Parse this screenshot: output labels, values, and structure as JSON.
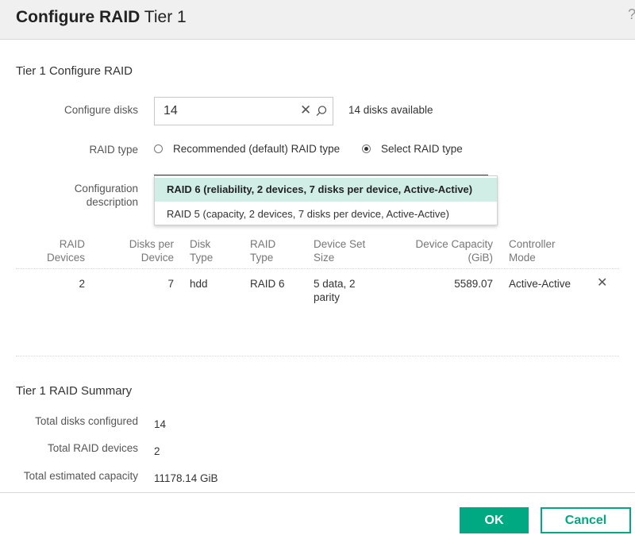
{
  "header": {
    "title_bold": "Configure RAID",
    "title_rest": "Tier 1",
    "help_icon": "help-icon"
  },
  "configure": {
    "section_title": "Tier 1 Configure RAID",
    "disks_label": "Configure disks",
    "disks_value": "14",
    "disks_available": "14 disks available",
    "raid_type_label": "RAID type",
    "raid_options": [
      "Recommended (default) RAID type",
      "Select RAID type"
    ],
    "raid_selected": "Select RAID type",
    "config_desc_label_1": "Configuration",
    "config_desc_label_2": "description"
  },
  "dropdown": {
    "options": [
      "RAID 6 (reliability, 2 devices, 7 disks per device, Active-Active)",
      "RAID 5 (capacity, 2 devices, 7 disks per device, Active-Active)"
    ],
    "selected_index": 0
  },
  "table": {
    "headers": {
      "raid_devices": [
        "RAID",
        "Devices"
      ],
      "disks_per_device": [
        "Disks per",
        "Device"
      ],
      "disk_type": [
        "Disk",
        "Type"
      ],
      "raid_type": [
        "RAID",
        "Type"
      ],
      "device_set_size": [
        "Device Set",
        "Size"
      ],
      "device_capacity": [
        "Device Capacity",
        "(GiB)"
      ],
      "controller_mode": [
        "Controller",
        "Mode"
      ]
    },
    "rows": [
      {
        "raid_devices": "2",
        "disks_per_device": "7",
        "disk_type": "hdd",
        "raid_type": "RAID 6",
        "device_set_size_1": "5 data, 2",
        "device_set_size_2": "parity",
        "device_capacity": "5589.07",
        "controller_mode": "Active-Active"
      }
    ]
  },
  "summary": {
    "section_title": "Tier 1 RAID Summary",
    "total_disks_label": "Total disks configured",
    "total_disks_value": "14",
    "total_raid_label": "Total RAID devices",
    "total_raid_value": "2",
    "total_capacity_label": "Total estimated capacity",
    "total_capacity_value": "11178.14 GiB"
  },
  "footer": {
    "ok_label": "OK",
    "cancel_label": "Cancel"
  },
  "colors": {
    "accent": "#01a982",
    "selected_option_bg": "#d1eee6"
  }
}
